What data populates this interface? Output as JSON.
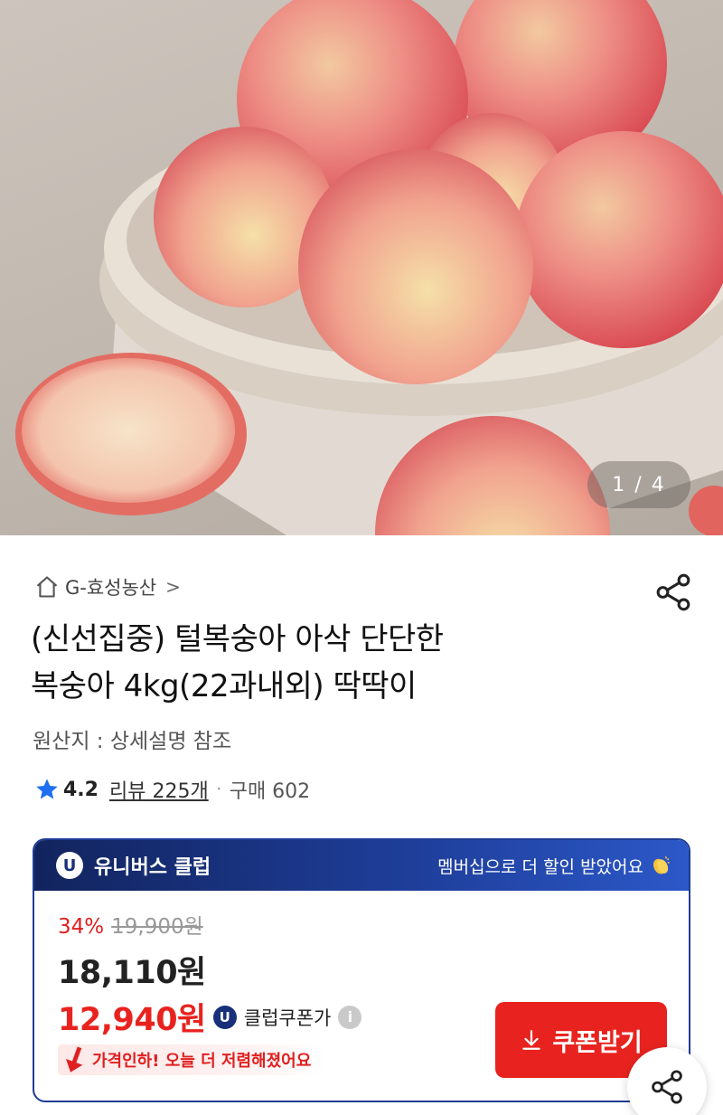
{
  "hero": {
    "image_alt": "",
    "counter": "1 / 4"
  },
  "product": {
    "store_name": "G-효성농산",
    "store_chevron": ">",
    "title_line1": "(신선집중) 털복숭아 아삭 단단한",
    "title_line2": "복숭아 4kg(22과내외) 딱딱이",
    "origin": "원산지 : 상세설명 참조",
    "rating": "4.2",
    "reviews": "리뷰 225개",
    "dot": "·",
    "purchases": "구매 602"
  },
  "club": {
    "badge": "U",
    "name": "유니버스 클럽",
    "message": "멤버십으로 더 할인 받았어요",
    "discount_pct": "34%",
    "original_price": "19,900원",
    "sale_price": "18,110원",
    "coupon_price": "12,940원",
    "coupon_label": "클럽쿠폰가",
    "info": "i",
    "price_drop": "가격인하! 오늘 더 저렴해졌어요",
    "coupon_button": "쿠폰받기"
  },
  "colors": {
    "accent_red": "#e8231f",
    "club_navy": "#1f3c95"
  },
  "icons": {
    "home": "home-icon",
    "share": "share-icon",
    "star": "star-icon",
    "clap": "clap-icon",
    "info": "info-icon",
    "download": "download-icon",
    "price_drop": "down-arrow-icon"
  }
}
